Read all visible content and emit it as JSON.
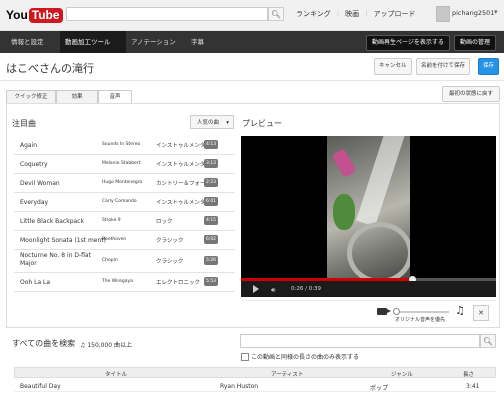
{
  "header": {
    "logo_you": "You",
    "logo_tube": "Tube",
    "search_placeholder": "",
    "nav": [
      "ランキング",
      "映画",
      "アップロード"
    ],
    "username": "pichang2501"
  },
  "editor_nav": {
    "tabs": [
      "情報と設定",
      "動画加工ツール",
      "アノテーション",
      "字幕"
    ],
    "active_tab": "動画加工ツール",
    "view_page_button": "動画再生ページを表示する",
    "manager_button": "動画の管理"
  },
  "page": {
    "title": "はこべさんの滝行",
    "cancel": "キャンセル",
    "save_as_new": "名前を付けて保存",
    "save": "保存",
    "restore": "最初の状態に戻す"
  },
  "tools_tabs": [
    "クイック修正",
    "効果",
    "音声"
  ],
  "active_tool_tab": "音声",
  "songs": {
    "heading": "注目曲",
    "sort_label": "人気の曲",
    "items": [
      {
        "title": "Again",
        "artist": "Sounds In Stereo",
        "genre": "インストゥルメンタル",
        "duration": "4:13"
      },
      {
        "title": "Coquetry",
        "artist": "Melanie Stabbert",
        "genre": "インストゥルメンタル",
        "duration": "3:13"
      },
      {
        "title": "Devil Woman",
        "artist": "Hugo Montenegro",
        "genre": "カントリー＆フォーク",
        "duration": "2:23"
      },
      {
        "title": "Everyday",
        "artist": "Carly Comando",
        "genre": "インストゥルメンタル",
        "duration": "6:01"
      },
      {
        "title": "Little Black Backpack",
        "artist": "Stroke 9",
        "genre": "ロック",
        "duration": "4:15"
      },
      {
        "title": "Moonlight Sonata (1st ment)",
        "artist": "Beethoven",
        "genre": "クラシック",
        "duration": "6:02"
      },
      {
        "title": "Nocturne No. 8 in D-flat Major",
        "artist": "Chopin",
        "genre": "クラシック",
        "duration": "5:26"
      },
      {
        "title": "Ooh La La",
        "artist": "The Wiregaya",
        "genre": "エレクトロニック",
        "duration": "5:53"
      }
    ]
  },
  "preview": {
    "heading": "プレビュー",
    "time": "0:26 / 0:39",
    "progress": 0.67,
    "original_audio_label": "オリジナル音声を優先"
  },
  "library": {
    "heading": "すべての曲を検索",
    "count": "150,000 曲以上",
    "match_length_label": "この動画と同様の長さの曲のみ表示する",
    "columns": [
      "タイトル",
      "アーティスト",
      "ジャンル",
      "長さ"
    ],
    "rows": [
      {
        "title": "Beautiful Day",
        "artist": "Ryan Huston",
        "genre": "ポップ",
        "duration": "3:41"
      }
    ]
  }
}
